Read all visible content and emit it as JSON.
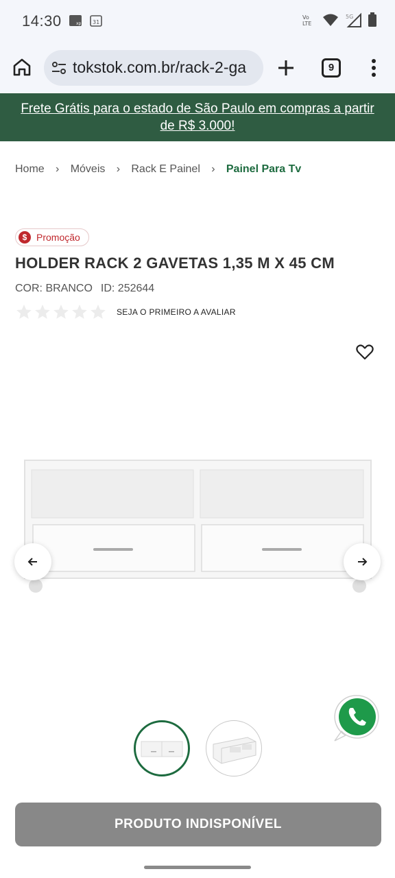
{
  "status_bar": {
    "time": "14:30",
    "icons": [
      "xp-badge-icon",
      "calendar-31-icon",
      "volte-icon",
      "wifi-icon",
      "5g-signal-icon",
      "battery-icon"
    ],
    "calendar_day": "31",
    "volte_label": "Vo LTE",
    "network_label": "5G"
  },
  "browser": {
    "url": "tokstok.com.br/rack-2-ga",
    "tab_count": "9"
  },
  "promo_banner": {
    "line1": "Frete Grátis para o estado de São Paulo em compras a partir",
    "line2": "de R$ 3.000!",
    "color": "#2f5c42"
  },
  "breadcrumb": {
    "items": [
      "Home",
      "Móveis",
      "Rack E Painel"
    ],
    "current": "Painel Para Tv"
  },
  "product": {
    "badge": "Promoção",
    "badge_symbol": "$",
    "title": "HOLDER RACK 2 GAVETAS 1,35 M X 45 CM",
    "color_label": "COR: BRANCO",
    "id_label": "ID: 252644",
    "rating_text": "SEJA O PRIMEIRO A AVALIAR",
    "rating_stars": 0,
    "rating_max": 5,
    "thumbnails_count": 2,
    "selected_thumbnail": 1
  },
  "cta": {
    "label": "PRODUTO INDISPONÍVEL",
    "color": "#888888"
  },
  "colors": {
    "accent_green": "#1d6b3f",
    "promo_red": "#c0282d"
  }
}
